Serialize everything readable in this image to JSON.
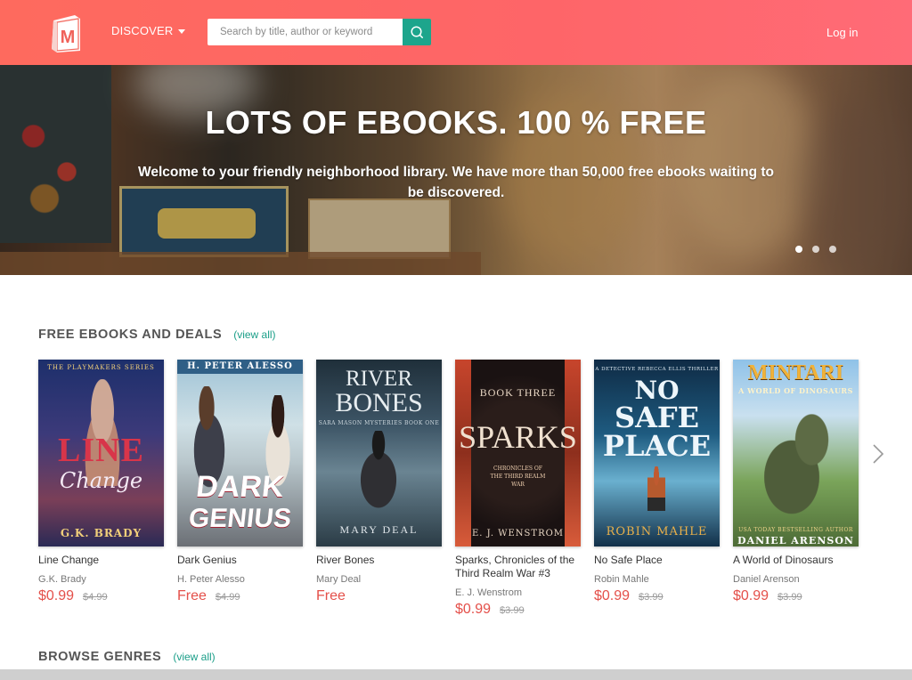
{
  "header": {
    "logo_letter": "M",
    "discover_label": "DISCOVER",
    "search_placeholder": "Search by title, author or keyword",
    "login_label": "Log in",
    "colors": {
      "header_from": "#fe6a5e",
      "header_to": "#ff6b77",
      "search_button": "#1da58c"
    }
  },
  "hero": {
    "title": "LOTS OF EBOOKS. 100 % FREE",
    "subtitle": "Welcome to your friendly neighborhood library. We have more than 50,000 free ebooks waiting to be discovered.",
    "slide_count": 3,
    "active_slide": 1
  },
  "section": {
    "title": "FREE EBOOKS AND DEALS",
    "view_all": "(view all)"
  },
  "books": [
    {
      "title": "Line Change",
      "author": "G.K. Brady",
      "price": "$0.99",
      "old_price": "$4.99",
      "cover": {
        "top": "THE PLAYMAKERS SERIES",
        "main": "LINE",
        "script": "Change",
        "bottom": "G.K. BRADY"
      }
    },
    {
      "title": "Dark Genius",
      "author": "H. Peter Alesso",
      "price": "Free",
      "old_price": "$4.99",
      "cover": {
        "top": "H. PETER ALESSO",
        "main": "DARK",
        "main2": "GENIUS"
      }
    },
    {
      "title": "River Bones",
      "author": "Mary Deal",
      "price": "Free",
      "old_price": "",
      "cover": {
        "main": "RIVER",
        "main2": "BONES",
        "small": "SARA MASON MYSTERIES BOOK ONE",
        "bottom": "MARY DEAL"
      }
    },
    {
      "title": "Sparks, Chronicles of the Third Realm War #3",
      "author": "E. J. Wenstrom",
      "price": "$0.99",
      "old_price": "$3.99",
      "cover": {
        "top": "BOOK THREE",
        "main": "SPARKS",
        "small": "CHRONICLES OF THE THIRD REALM WAR",
        "bottom": "E. J. WENSTROM"
      }
    },
    {
      "title": "No Safe Place",
      "author": "Robin Mahle",
      "price": "$0.99",
      "old_price": "$3.99",
      "cover": {
        "top": "A DETECTIVE REBECCA ELLIS THRILLER",
        "main": "NO",
        "main2": "SAFE",
        "main3": "PLACE",
        "bottom": "ROBIN MAHLE"
      }
    },
    {
      "title": "A World of Dinosaurs",
      "author": "Daniel Arenson",
      "price": "$0.99",
      "old_price": "$3.99",
      "cover": {
        "main": "MINTARI",
        "small": "A WORLD OF DINOSAURS",
        "bottom": "DANIEL ARENSON",
        "top": "USA TODAY BESTSELLING AUTHOR"
      }
    }
  ],
  "browse": {
    "title": "BROWSE GENRES",
    "view_all": "(view all)"
  }
}
